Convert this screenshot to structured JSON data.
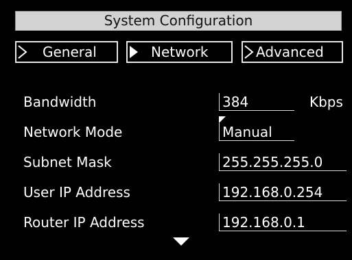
{
  "header": {
    "title": "System Configuration"
  },
  "tabs": [
    {
      "label": "General",
      "selected": false
    },
    {
      "label": "Network",
      "selected": true
    },
    {
      "label": "Advanced",
      "selected": false
    }
  ],
  "settings": [
    {
      "label": "Bandwidth",
      "value": "384",
      "unit": "Kbps"
    },
    {
      "label": "Network Mode",
      "value": "Manual"
    },
    {
      "label": "Subnet Mask",
      "value": "255.255.255.0"
    },
    {
      "label": "User IP Address",
      "value": "192.168.0.254"
    },
    {
      "label": "Router IP Address",
      "value": "192.168.0.1"
    }
  ],
  "icons": {
    "tab_arrow": "chevron-right-icon",
    "scroll": "triangle-down-icon"
  },
  "colors": {
    "background": "#000000",
    "title_bar": "#d2d2d2",
    "text": "#ffffff"
  }
}
